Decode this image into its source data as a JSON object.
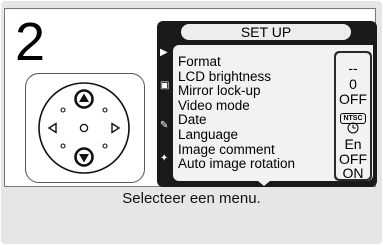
{
  "step": {
    "number": "2"
  },
  "lcd": {
    "title": "SET UP",
    "items": [
      "Format",
      "LCD brightness",
      "Mirror lock-up",
      "Video mode",
      "Date",
      "Language",
      "Image comment",
      "Auto image rotation"
    ],
    "values": [
      "--",
      "0",
      "OFF",
      "NTSC",
      "clock-icon",
      "En",
      "OFF",
      "ON"
    ],
    "side_icons": [
      "playback-icon",
      "camera-icon",
      "pencil-icon",
      "wrench-icon"
    ]
  },
  "multi_selector": {
    "highlighted": [
      "up",
      "down"
    ]
  },
  "caption": "Selecteer een menu."
}
